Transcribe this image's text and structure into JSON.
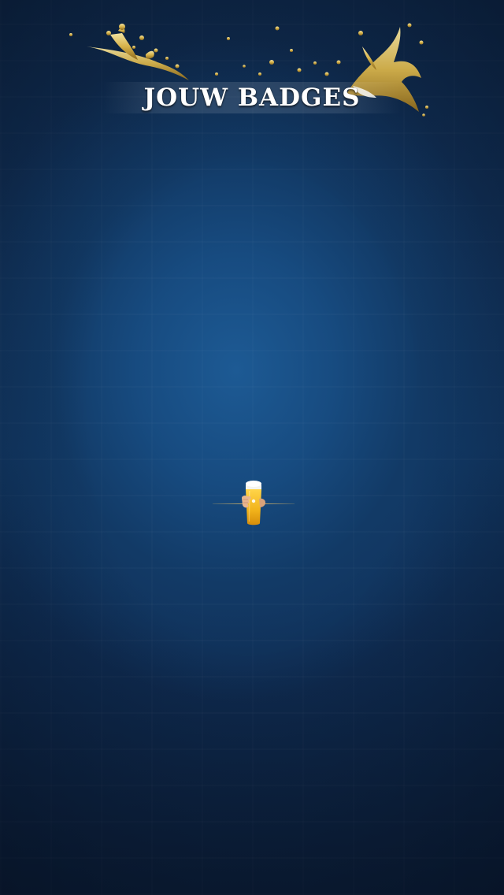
{
  "header": {
    "title": "JOUW BADGES",
    "splash_icon": "beer-splash-icon"
  },
  "loading": {
    "icon": "beer-glass-icon"
  },
  "colors": {
    "background_top": "#0f2a4d",
    "background_center": "#1d5a94",
    "background_bottom": "#0c1f3a",
    "accent_gold": "#d6b24a",
    "title_text": "#ffffff"
  }
}
